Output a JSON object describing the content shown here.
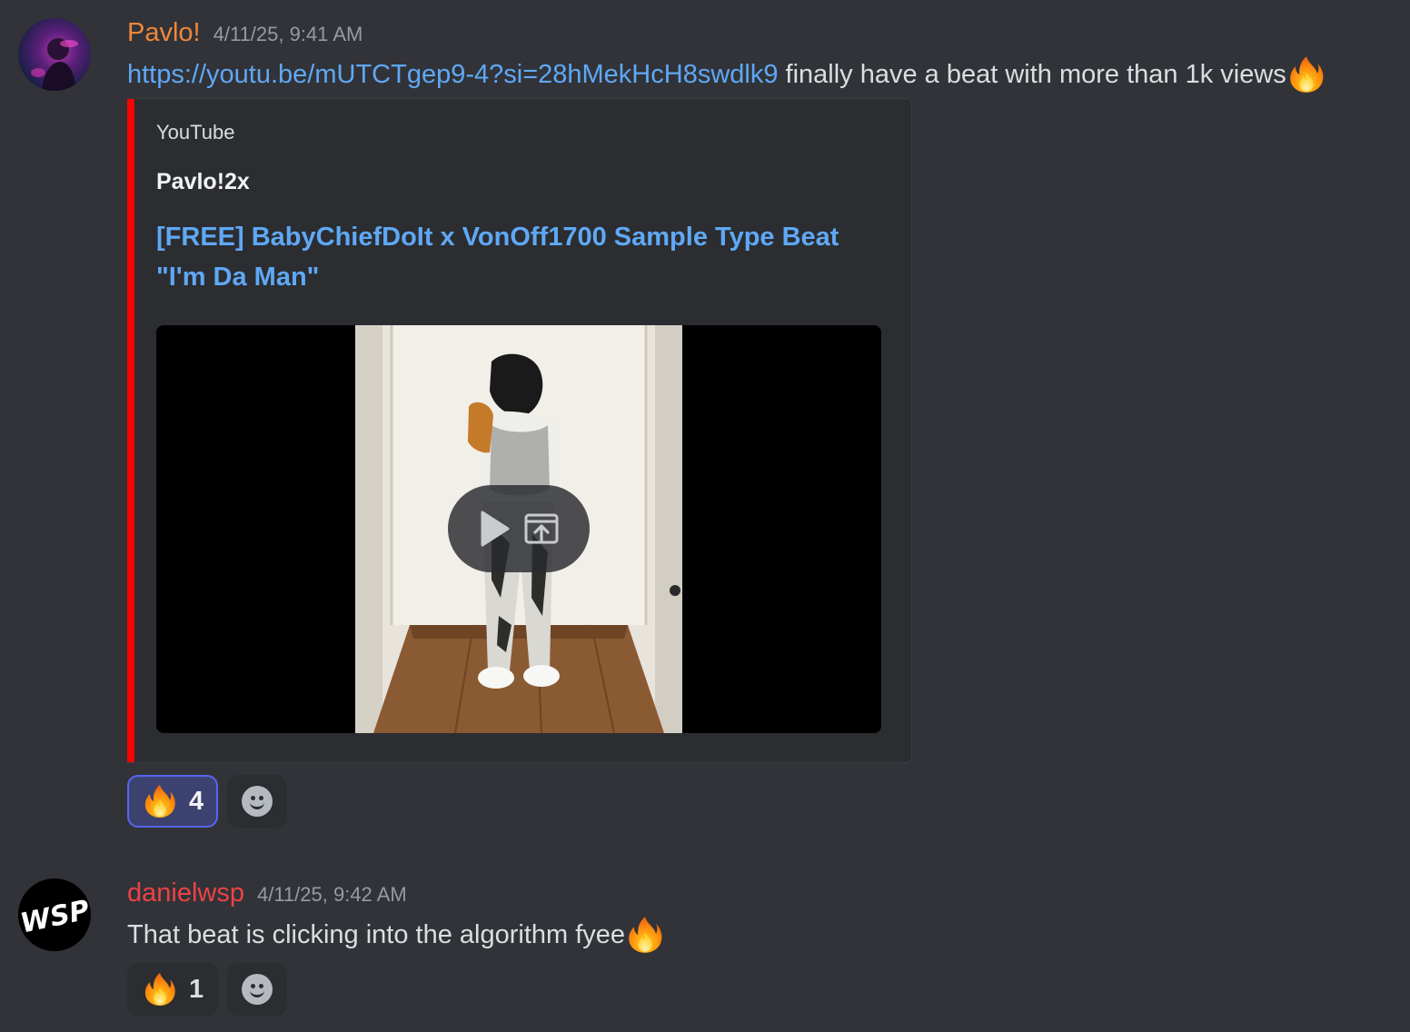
{
  "colors": {
    "background": "#313338",
    "embed_bar": "#ff0000",
    "link": "#5fa8f5",
    "user1_name": "#f0873b",
    "user2_name": "#ed4245",
    "reaction_active_border": "#5865f2"
  },
  "messages": [
    {
      "username": "Pavlo!",
      "timestamp": "4/11/25, 9:41 AM",
      "link": "https://youtu.be/mUTCTgep9-4?si=28hMekHcH8swdlk9",
      "text": " finally have a beat with more than 1k views",
      "emoji": "fire-emoji",
      "embed": {
        "provider": "YouTube",
        "author": "Pavlo!2x",
        "title": "[FREE] BabyChiefDoIt x VonOff1700 Sample Type Beat \"I'm Da Man\"",
        "icons": [
          "play-icon",
          "open-external-icon"
        ]
      },
      "reactions": [
        {
          "emoji": "fire-emoji",
          "count": "4",
          "active": true
        }
      ]
    },
    {
      "username": "danielwsp",
      "timestamp": "4/11/25, 9:42 AM",
      "text": "That beat is clicking into the algorithm fyee",
      "emoji": "fire-emoji",
      "avatar_text": "WSP",
      "reactions": [
        {
          "emoji": "fire-emoji",
          "count": "1",
          "active": false
        }
      ]
    }
  ]
}
